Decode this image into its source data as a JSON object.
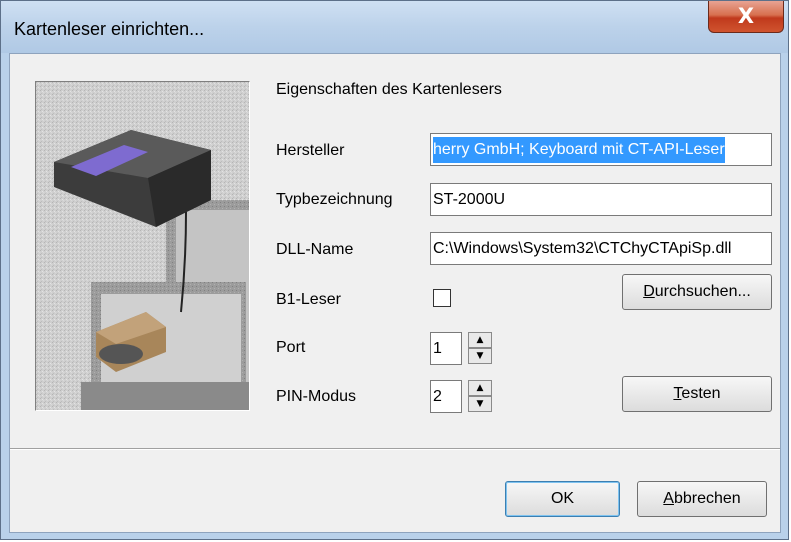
{
  "window": {
    "title": "Kartenleser einrichten...",
    "close_glyph": "X"
  },
  "section_title": "Eigenschaften des Kartenlesers",
  "hersteller": {
    "label": "Hersteller",
    "value": "herry GmbH; Keyboard mit CT-API-Leser"
  },
  "typ": {
    "label": "Typbezeichnung",
    "value": "ST-2000U"
  },
  "dll": {
    "label": "DLL-Name",
    "value": "C:\\Windows\\System32\\CTChyCTApiSp.dll"
  },
  "b1": {
    "label": "B1-Leser",
    "checked": false
  },
  "browse_button": {
    "prefix": "",
    "underline": "D",
    "rest": "urchsuchen..."
  },
  "port": {
    "label": "Port",
    "value": "1"
  },
  "pin": {
    "label": "PIN-Modus",
    "value": "2"
  },
  "test_button": {
    "prefix": "",
    "underline": "T",
    "rest": "esten"
  },
  "ok_button": {
    "label": "OK"
  },
  "cancel_button": {
    "prefix": "",
    "underline": "A",
    "rest": "bbrechen"
  },
  "icons": {
    "spin_up": "▲",
    "spin_down": "▼",
    "illustration": "card-reader-illustration"
  }
}
